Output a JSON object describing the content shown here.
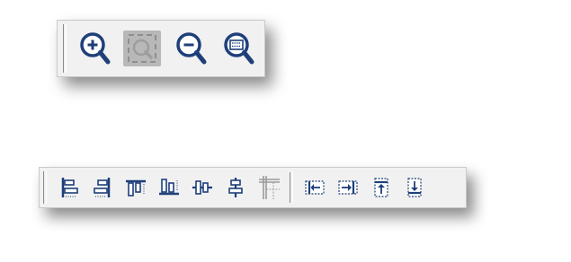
{
  "zoom_toolbar": {
    "buttons": [
      {
        "name": "zoom-in",
        "icon": "zoom-in-icon",
        "enabled": true
      },
      {
        "name": "zoom-pan",
        "icon": "zoom-pan-icon",
        "enabled": false
      },
      {
        "name": "zoom-out",
        "icon": "zoom-out-icon",
        "enabled": true
      },
      {
        "name": "zoom-fit",
        "icon": "zoom-fit-icon",
        "enabled": true
      }
    ]
  },
  "align_toolbar": {
    "buttons": [
      {
        "name": "align-left",
        "icon": "align-left-icon",
        "enabled": true
      },
      {
        "name": "align-right",
        "icon": "align-right-icon",
        "enabled": true
      },
      {
        "name": "align-top",
        "icon": "align-top-icon",
        "enabled": true
      },
      {
        "name": "align-bottom",
        "icon": "align-bottom-icon",
        "enabled": true
      },
      {
        "name": "align-center-vertical",
        "icon": "align-middle-icon",
        "enabled": true
      },
      {
        "name": "align-center-horizontal",
        "icon": "align-center-icon",
        "enabled": true
      },
      {
        "name": "align-to-grid",
        "icon": "grid-align-icon",
        "enabled": false
      },
      {
        "name": "space-horizontal-left",
        "icon": "space-left-icon",
        "enabled": true
      },
      {
        "name": "space-horizontal-right",
        "icon": "space-right-icon",
        "enabled": true
      },
      {
        "name": "space-vertical-up",
        "icon": "space-up-icon",
        "enabled": true
      },
      {
        "name": "space-vertical-down",
        "icon": "space-down-icon",
        "enabled": true
      }
    ]
  },
  "colors": {
    "icon_blue": "#1f3f7a",
    "icon_disabled": "#9a9a9a",
    "toolbar_bg": "#f1f1f1"
  }
}
